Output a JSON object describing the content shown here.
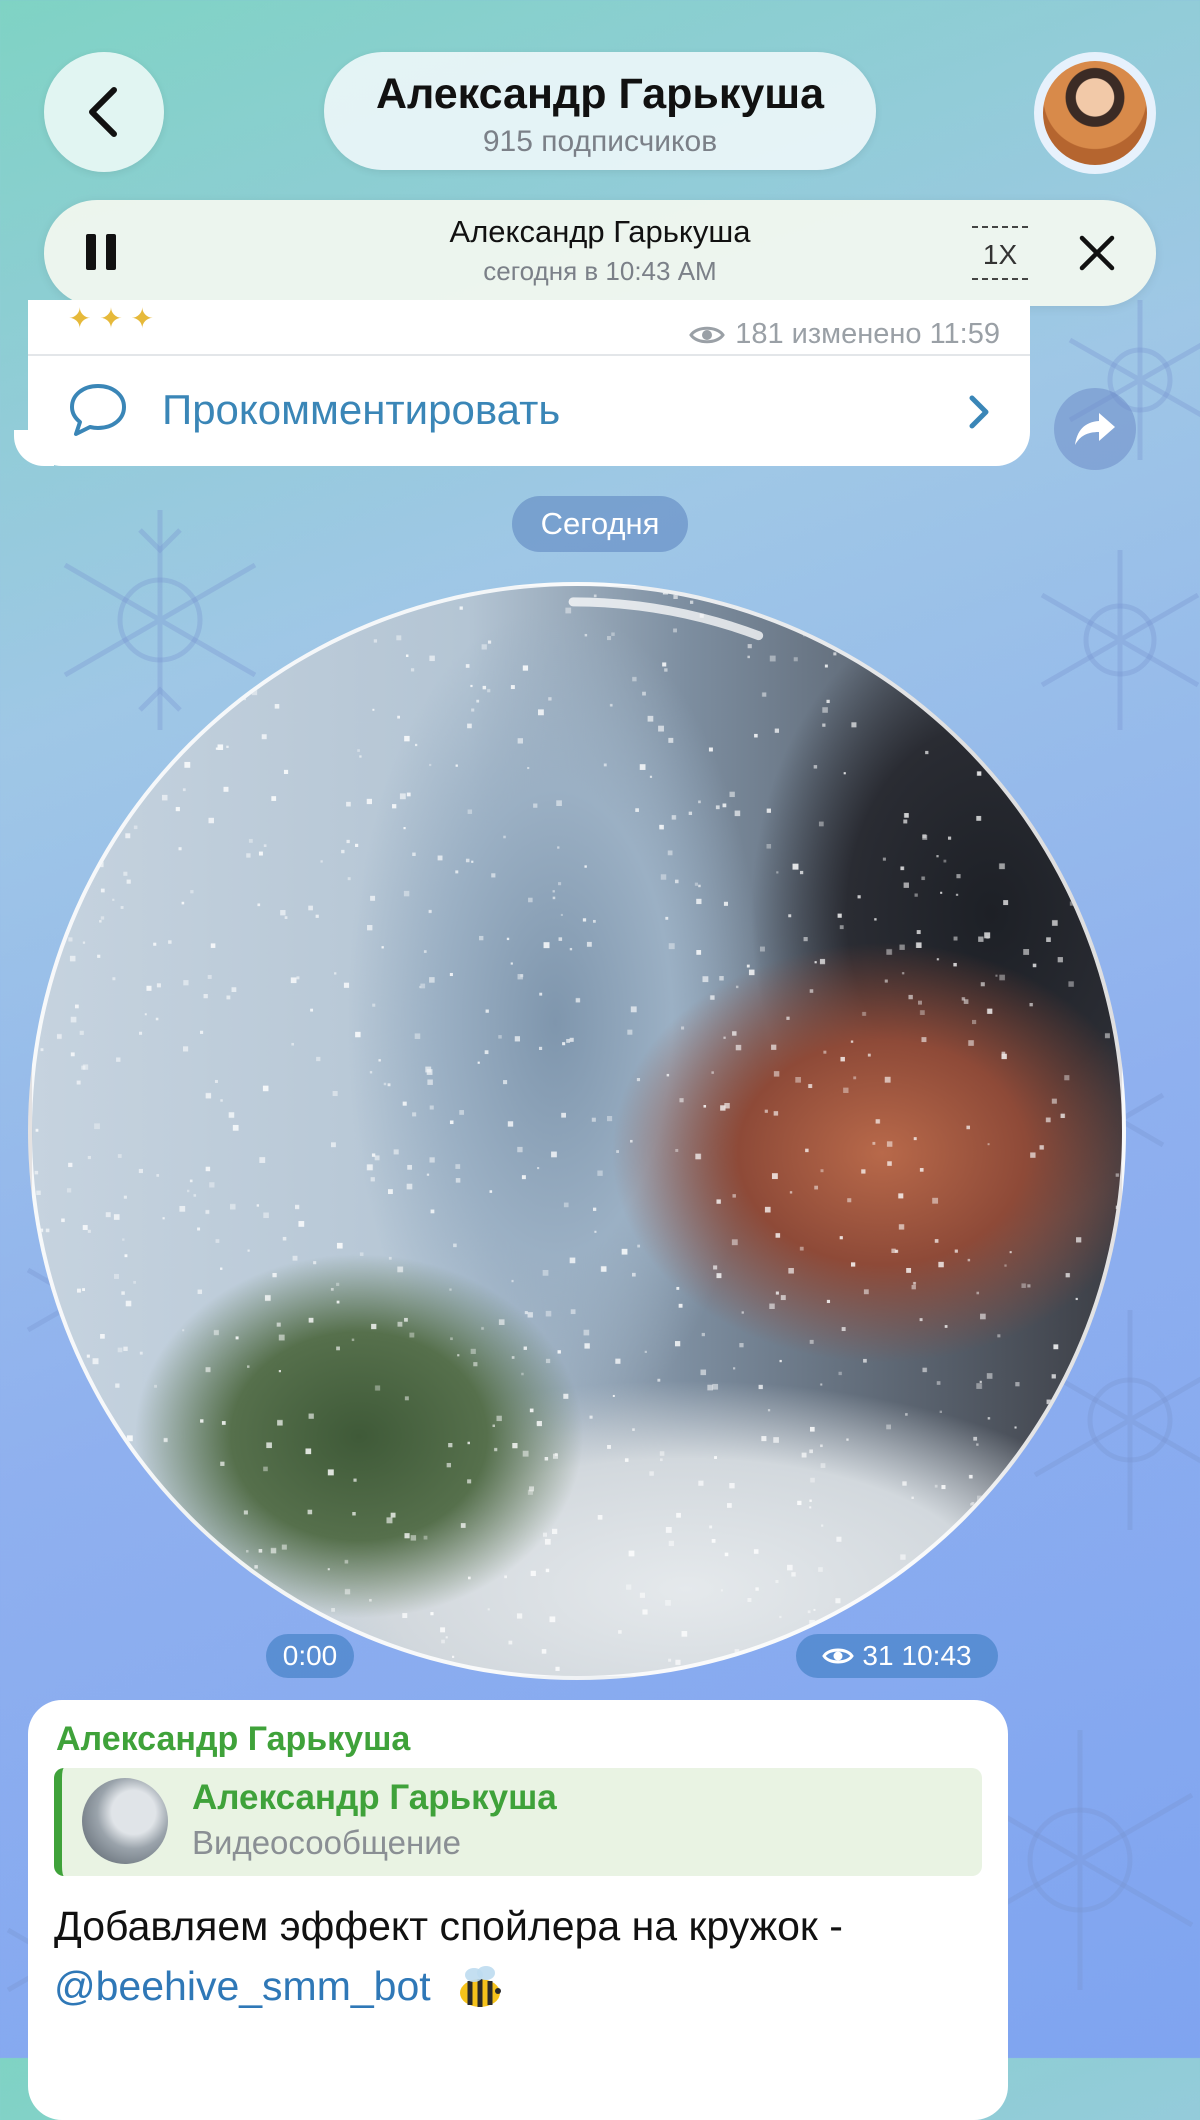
{
  "header": {
    "channel_name": "Александр Гарькуша",
    "subscribers": "915 подписчиков"
  },
  "player": {
    "title": "Александр Гарькуша",
    "subtitle": "сегодня в 10:43 AM",
    "speed": "1X"
  },
  "previous_post": {
    "views_edited": "181 изменено 11:59",
    "comment_label": "Прокомментировать"
  },
  "date_separator": "Сегодня",
  "video_message": {
    "duration": "0:00",
    "views": "31",
    "time": "10:43"
  },
  "message": {
    "author": "Александр Гарькуша",
    "reply": {
      "name": "Александр Гарькуша",
      "type": "Видеосообщение"
    },
    "text": "Добавляем эффект спойлера на кружок -",
    "link": "@beehive_smm_bot"
  },
  "colors": {
    "accent_green": "#3fa23a",
    "link_blue": "#2f78b7",
    "comment_blue": "#3a86b7"
  },
  "icons": [
    "back-chevron-icon",
    "pause-icon",
    "close-icon",
    "eye-icon",
    "comment-icon",
    "chevron-right-icon",
    "share-icon",
    "bee-emoji-icon"
  ]
}
